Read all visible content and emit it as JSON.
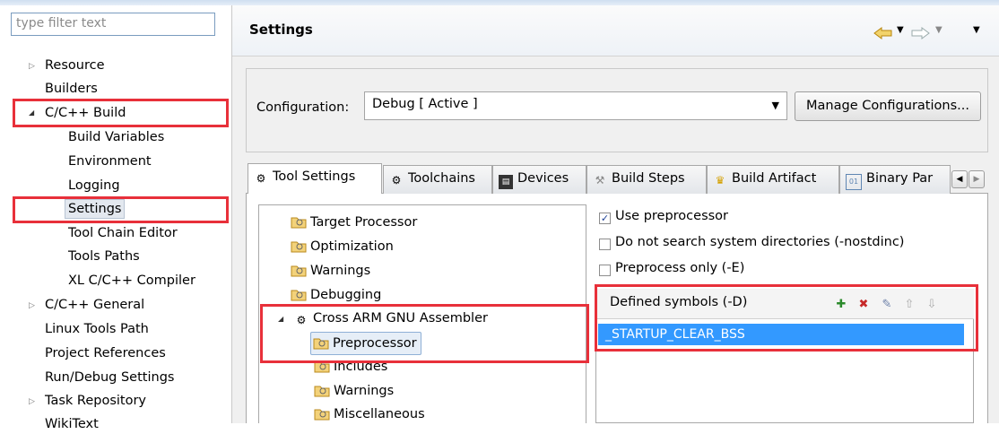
{
  "filter": {
    "placeholder": "type filter text"
  },
  "tree": {
    "items": [
      {
        "label": "Resource",
        "expander": "▷"
      },
      {
        "label": "Builders"
      },
      {
        "label": "C/C++ Build",
        "expander": "◢"
      },
      {
        "label": "Build Variables"
      },
      {
        "label": "Environment"
      },
      {
        "label": "Logging"
      },
      {
        "label": "Settings"
      },
      {
        "label": "Tool Chain Editor"
      },
      {
        "label": "Tools Paths"
      },
      {
        "label": "XL C/C++ Compiler"
      },
      {
        "label": "C/C++ General",
        "expander": "▷"
      },
      {
        "label": "Linux Tools Path"
      },
      {
        "label": "Project References"
      },
      {
        "label": "Run/Debug Settings"
      },
      {
        "label": "Task Repository",
        "expander": "▷"
      },
      {
        "label": "WikiText"
      }
    ]
  },
  "header": {
    "title": "Settings",
    "back_icon": "back-arrow-icon",
    "forward_icon": "forward-arrow-icon"
  },
  "config": {
    "label": "Configuration:",
    "value": "Debug  [ Active ]",
    "manage_button": "Manage Configurations..."
  },
  "tabs": [
    {
      "label": "Tool Settings",
      "icon": "gear-icon"
    },
    {
      "label": "Toolchains",
      "icon": "gear-icon"
    },
    {
      "label": "Devices",
      "icon": "chip-icon"
    },
    {
      "label": "Build Steps",
      "icon": "hammer-icon"
    },
    {
      "label": "Build Artifact",
      "icon": "trophy-icon"
    },
    {
      "label": "Binary Par",
      "icon": "binary-icon"
    }
  ],
  "tool_tree": [
    {
      "label": "Target Processor"
    },
    {
      "label": "Optimization"
    },
    {
      "label": "Warnings"
    },
    {
      "label": "Debugging"
    },
    {
      "label": "Cross ARM GNU Assembler",
      "expander": "◢"
    },
    {
      "label": "Preprocessor"
    },
    {
      "label": "Includes"
    },
    {
      "label": "Warnings"
    },
    {
      "label": "Miscellaneous"
    }
  ],
  "options": [
    {
      "label": "Use preprocessor",
      "checked": true
    },
    {
      "label": "Do not search system directories (-nostdinc)",
      "checked": false
    },
    {
      "label": "Preprocess only (-E)",
      "checked": false
    }
  ],
  "symbols": {
    "title": "Defined symbols (-D)",
    "items": [
      "_STARTUP_CLEAR_BSS"
    ],
    "toolbar": [
      "add-icon",
      "delete-icon",
      "edit-icon",
      "move-up-icon",
      "move-down-icon"
    ]
  },
  "colors": {
    "highlight_red": "#e8303a",
    "selection_blue": "#3399ff"
  }
}
